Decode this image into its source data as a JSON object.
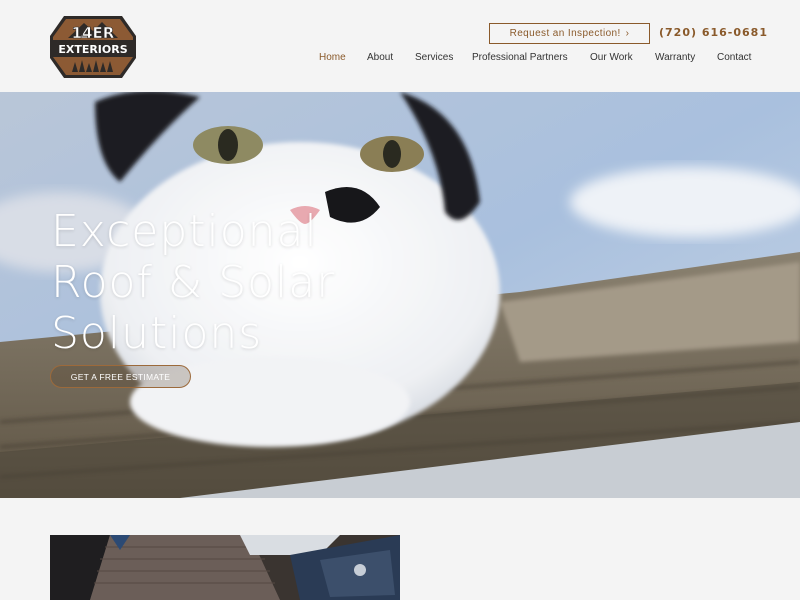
{
  "brand": {
    "logo_line1": "14ER",
    "logo_line2": "EXTERIORS",
    "colors": {
      "accent": "#8a5a2b",
      "logo_fill": "#8c5a34",
      "logo_dark": "#2e2a28"
    }
  },
  "header": {
    "cta_label": "Request an Inspection!",
    "cta_icon": "chevron-right-icon",
    "phone": "(720) 616-0681"
  },
  "nav": {
    "items": [
      {
        "label": "Home",
        "active": true
      },
      {
        "label": "About"
      },
      {
        "label": "Services"
      },
      {
        "label": "Professional Partners"
      },
      {
        "label": "Our Work"
      },
      {
        "label": "Warranty"
      },
      {
        "label": "Contact"
      }
    ]
  },
  "hero": {
    "title_lines": [
      "Exceptional",
      "Roof & Solar",
      "Solutions"
    ],
    "button_label": "GET A FREE ESTIMATE",
    "image_subject": "white-and-black-cat-on-roof"
  },
  "section2": {
    "image_subject": "roof-aerial-photo"
  }
}
